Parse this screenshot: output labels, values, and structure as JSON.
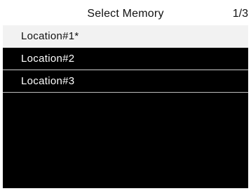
{
  "header": {
    "title": "Select Memory",
    "page_indicator": "1/3"
  },
  "memory_list": {
    "items": [
      {
        "label": "Location#1*",
        "selected": true
      },
      {
        "label": "Location#2",
        "selected": false
      },
      {
        "label": "Location#3",
        "selected": false
      }
    ]
  },
  "colors": {
    "background": "#000000",
    "header_background": "#ffffff",
    "selected_row_background": "#f2f2f2",
    "text_light": "#ffffff",
    "text_dark": "#111111"
  }
}
